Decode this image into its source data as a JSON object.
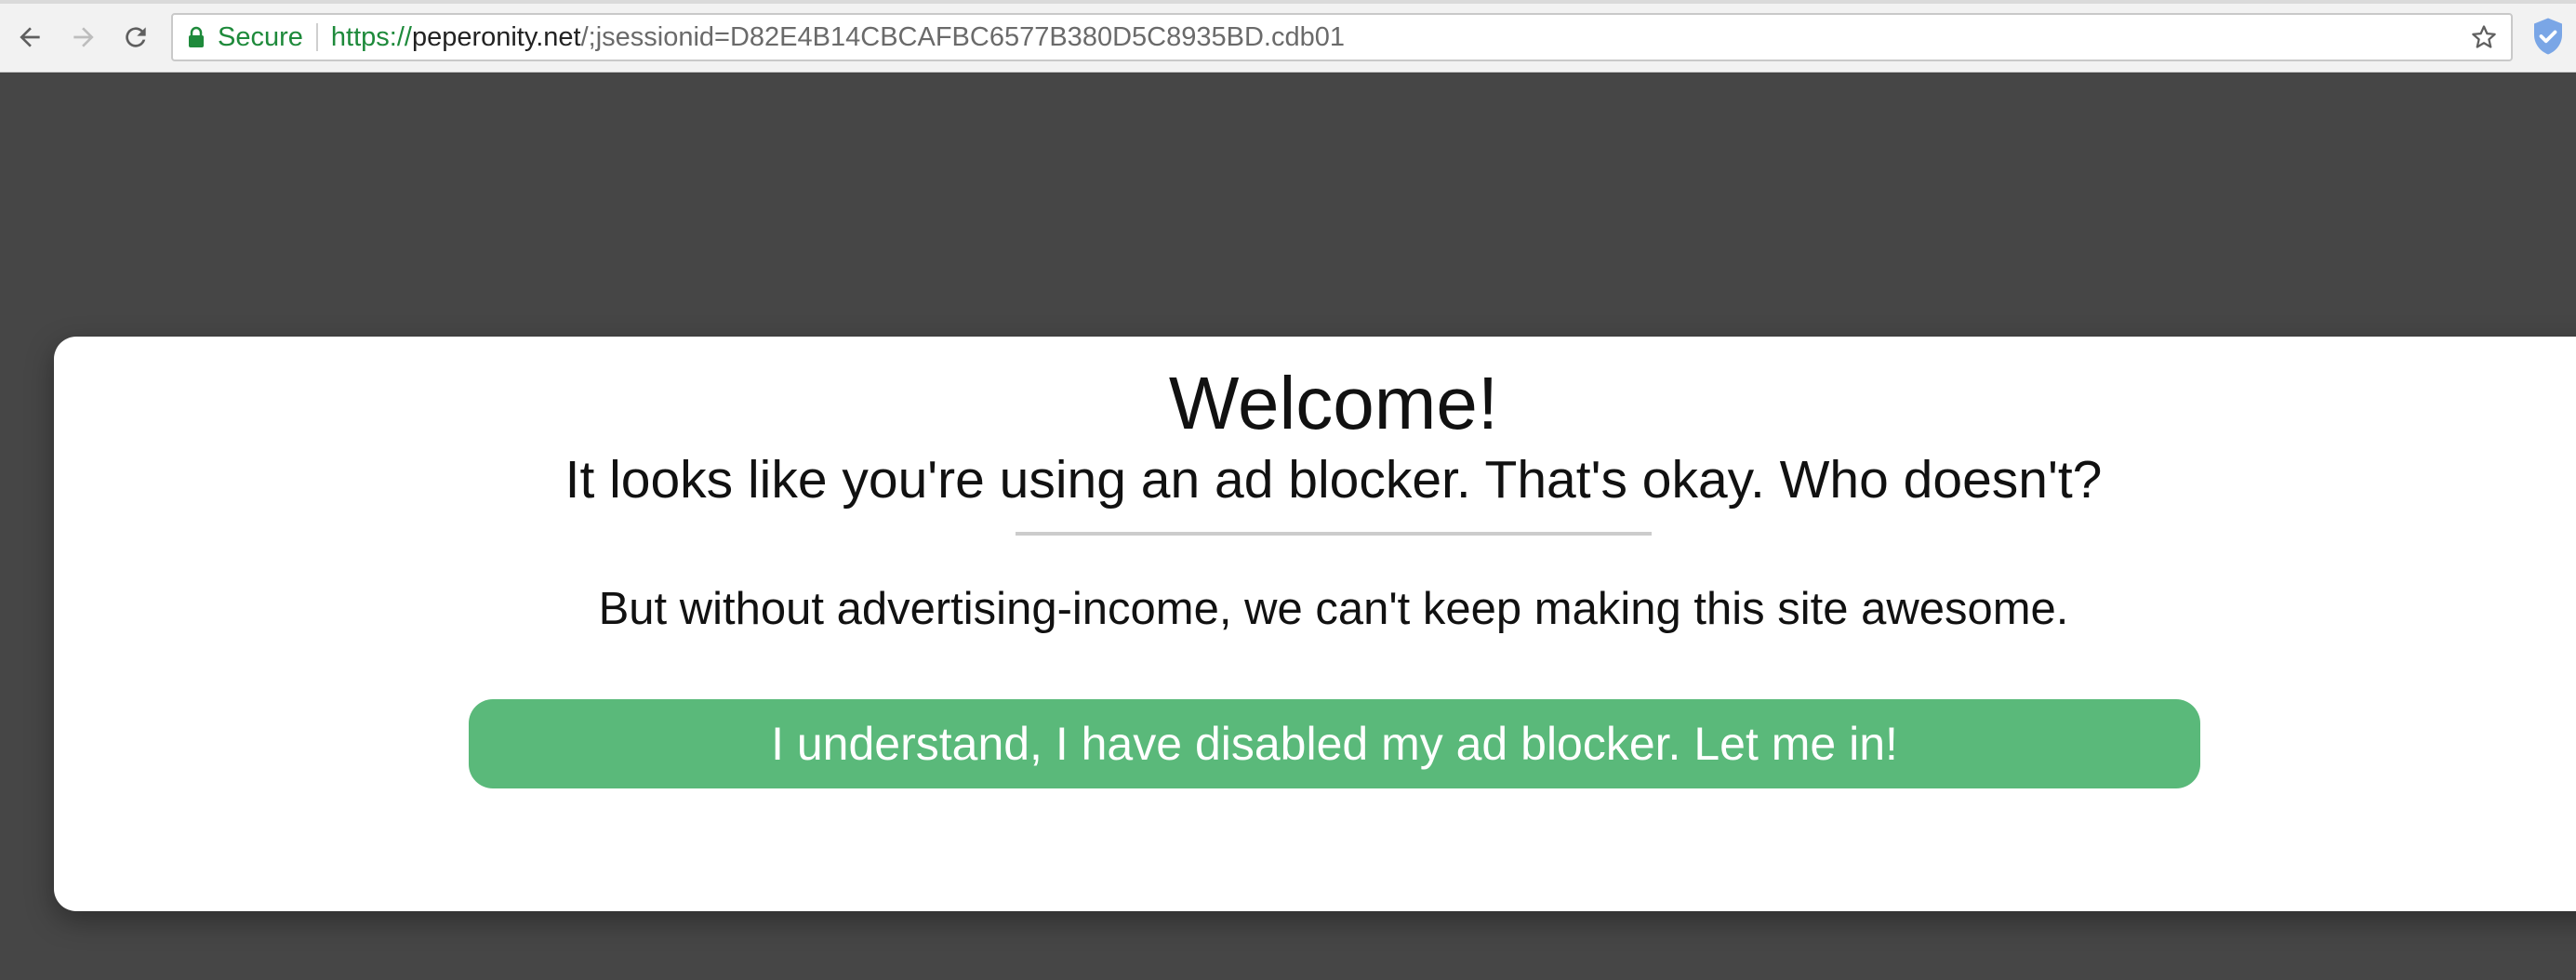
{
  "browser": {
    "secure_label": "Secure",
    "url_scheme": "https://",
    "url_host": "peperonity.net",
    "url_path": "/;jsessionid=D82E4B14CBCAFBC6577B380D5C8935BD.cdb01"
  },
  "modal": {
    "title": "Welcome!",
    "subtitle": "It looks like you're using an ad blocker. That's okay. Who doesn't?",
    "message": "But without advertising-income, we can't keep making this site awesome.",
    "button_label": "I understand, I have disabled my ad blocker. Let me in!"
  },
  "colors": {
    "page_background": "#464646",
    "button": "#5ab97a",
    "secure_green": "#1e8a3b"
  }
}
